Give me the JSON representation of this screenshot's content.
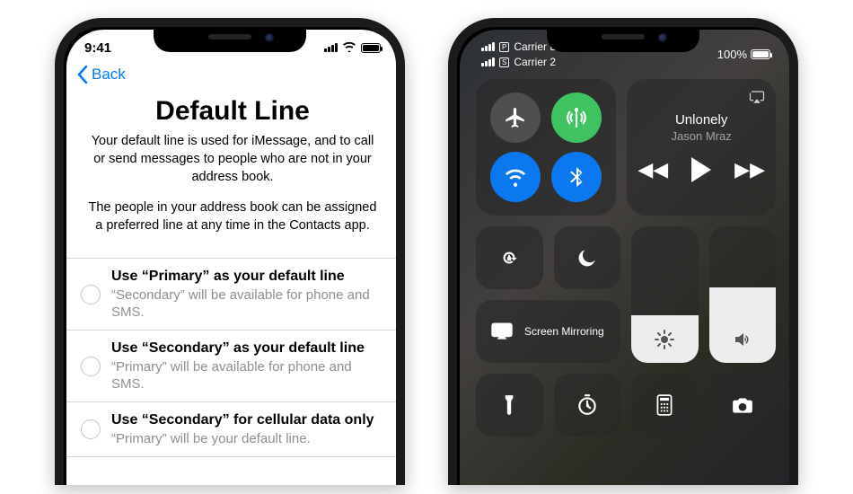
{
  "left": {
    "status_time": "9:41",
    "back_label": "Back",
    "title": "Default Line",
    "desc1": "Your default line is used for iMessage, and to call or send messages to people who are not in your address book.",
    "desc2": "The people in your address book can be assigned a preferred line at any time in the Contacts app.",
    "options": [
      {
        "title": "Use “Primary” as your default line",
        "subtitle": "“Secondary” will be available for phone and SMS."
      },
      {
        "title": "Use “Secondary” as your default line",
        "subtitle": "“Primary” will be available for phone and SMS."
      },
      {
        "title": "Use “Secondary” for cellular data only",
        "subtitle": "“Primary” will be your default line."
      }
    ]
  },
  "right": {
    "carrier1": "Carrier LTE",
    "carrier2": "Carrier 2",
    "sim1_badge": "P",
    "sim2_badge": "S",
    "battery_text": "100%",
    "media_title": "Unlonely",
    "media_artist": "Jason Mraz",
    "mirroring_label": "Screen Mirroring",
    "brightness_pct": 35,
    "volume_pct": 55
  }
}
